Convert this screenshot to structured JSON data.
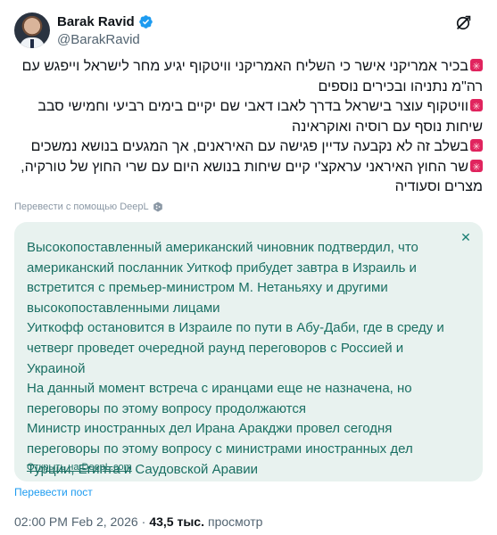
{
  "author": {
    "name": "Barak Ravid",
    "handle": "@BarakRavid"
  },
  "icons": {
    "verified": "verified-badge-icon",
    "grok": "grok-icon",
    "siren": "police-siren-emoji",
    "deepl": "deepl-logo-icon",
    "close": "close-icon"
  },
  "colors": {
    "verified_blue": "#1d9bf0",
    "translation_bg": "#e8f2ef",
    "translation_text": "#1a6f63",
    "link_blue": "#1d9bf0"
  },
  "tweet": {
    "paragraphs": [
      "בכיר אמריקני אישר כי השליח האמריקני וויטקוף יגיע מחר לישראל וייפגש עם רה\"מ נתניהו ובכירים נוספים",
      "וויטקוף עוצר בישראל בדרך לאבו דאבי שם יקיים בימים רביעי וחמישי סבב שיחות נוסף עם רוסיה ואוקראינה",
      "בשלב זה לא נקבעה עדיין פגישה עם האיראנים, אך המגעים בנושא נמשכים",
      "שר החוץ האיראני עראקצ'י קיים שיחות בנושא היום עם שרי החוץ של טורקיה, מצרים וסעודיה"
    ]
  },
  "translation": {
    "translated_by": "Перевести с помощью DeepL",
    "paragraphs": [
      "Высокопоставленный американский чиновник подтвердил, что американский посланник Уиткоф прибудет завтра в Израиль и встретится с премьер-министром М. Нетаньяху и другими высокопоставленными лицами",
      "Уиткофф остановится в Израиле по пути в Абу-Даби, где в среду и четверг проведет очередной раунд переговоров с Россией и Украиной",
      "На данный момент встреча с иранцами еще не назначена, но переговоры по этому вопросу продолжаются",
      "Министр иностранных дел Ирана Аракджи провел сегодня переговоры по этому вопросу с министрами иностранных дел Турции, Египта и Саудовской Аравии"
    ],
    "open_link": "Открыть на DeepL.com",
    "close_symbol": "✕"
  },
  "translate_post": "Перевести пост",
  "meta": {
    "time": "02:00 PM",
    "separator": "·",
    "date": "Feb 2, 2026",
    "views_count": "43,5 тыс.",
    "views_label": "просмотр"
  }
}
